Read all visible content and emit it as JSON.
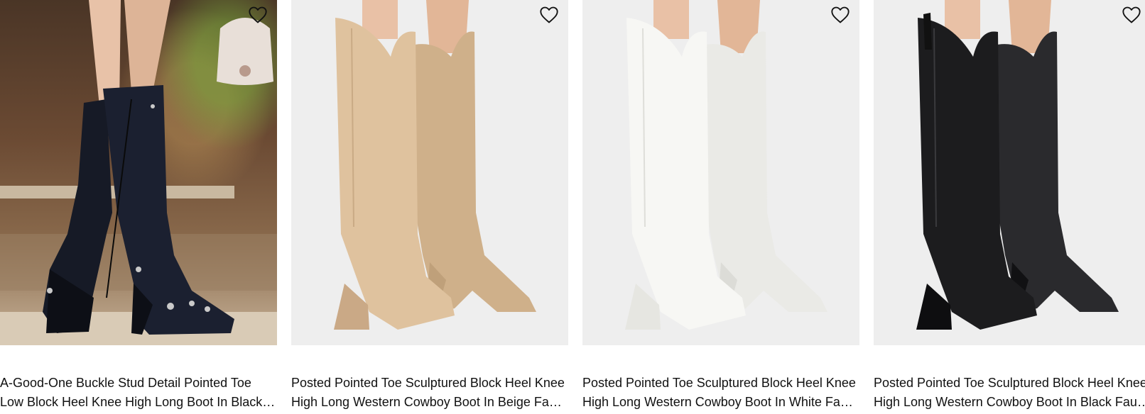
{
  "products": [
    {
      "title": "A-Good-One Buckle Stud Detail Pointed Toe Low Block Heel Knee High Long Boot In Black Croc Print Faux Leather",
      "image": "black croc buckle knee-high boots on model",
      "wishlist_icon": "heart-outline-icon"
    },
    {
      "title": "Posted Pointed Toe Sculptured Block Heel Knee High Long Western Cowboy Boot In Beige Faux Leather",
      "image": "beige western knee-high boots",
      "color": "#d9bf9b",
      "wishlist_icon": "heart-outline-icon"
    },
    {
      "title": "Posted Pointed Toe Sculptured Block Heel Knee High Long Western Cowboy Boot In White Faux Leather",
      "image": "white western knee-high boots",
      "color": "#f4f4f1",
      "wishlist_icon": "heart-outline-icon"
    },
    {
      "title": "Posted Pointed Toe Sculptured Block Heel Knee High Long Western Cowboy Boot In Black Faux Leather",
      "image": "black western knee-high boots",
      "color": "#1c1c1e",
      "wishlist_icon": "heart-outline-icon"
    }
  ]
}
